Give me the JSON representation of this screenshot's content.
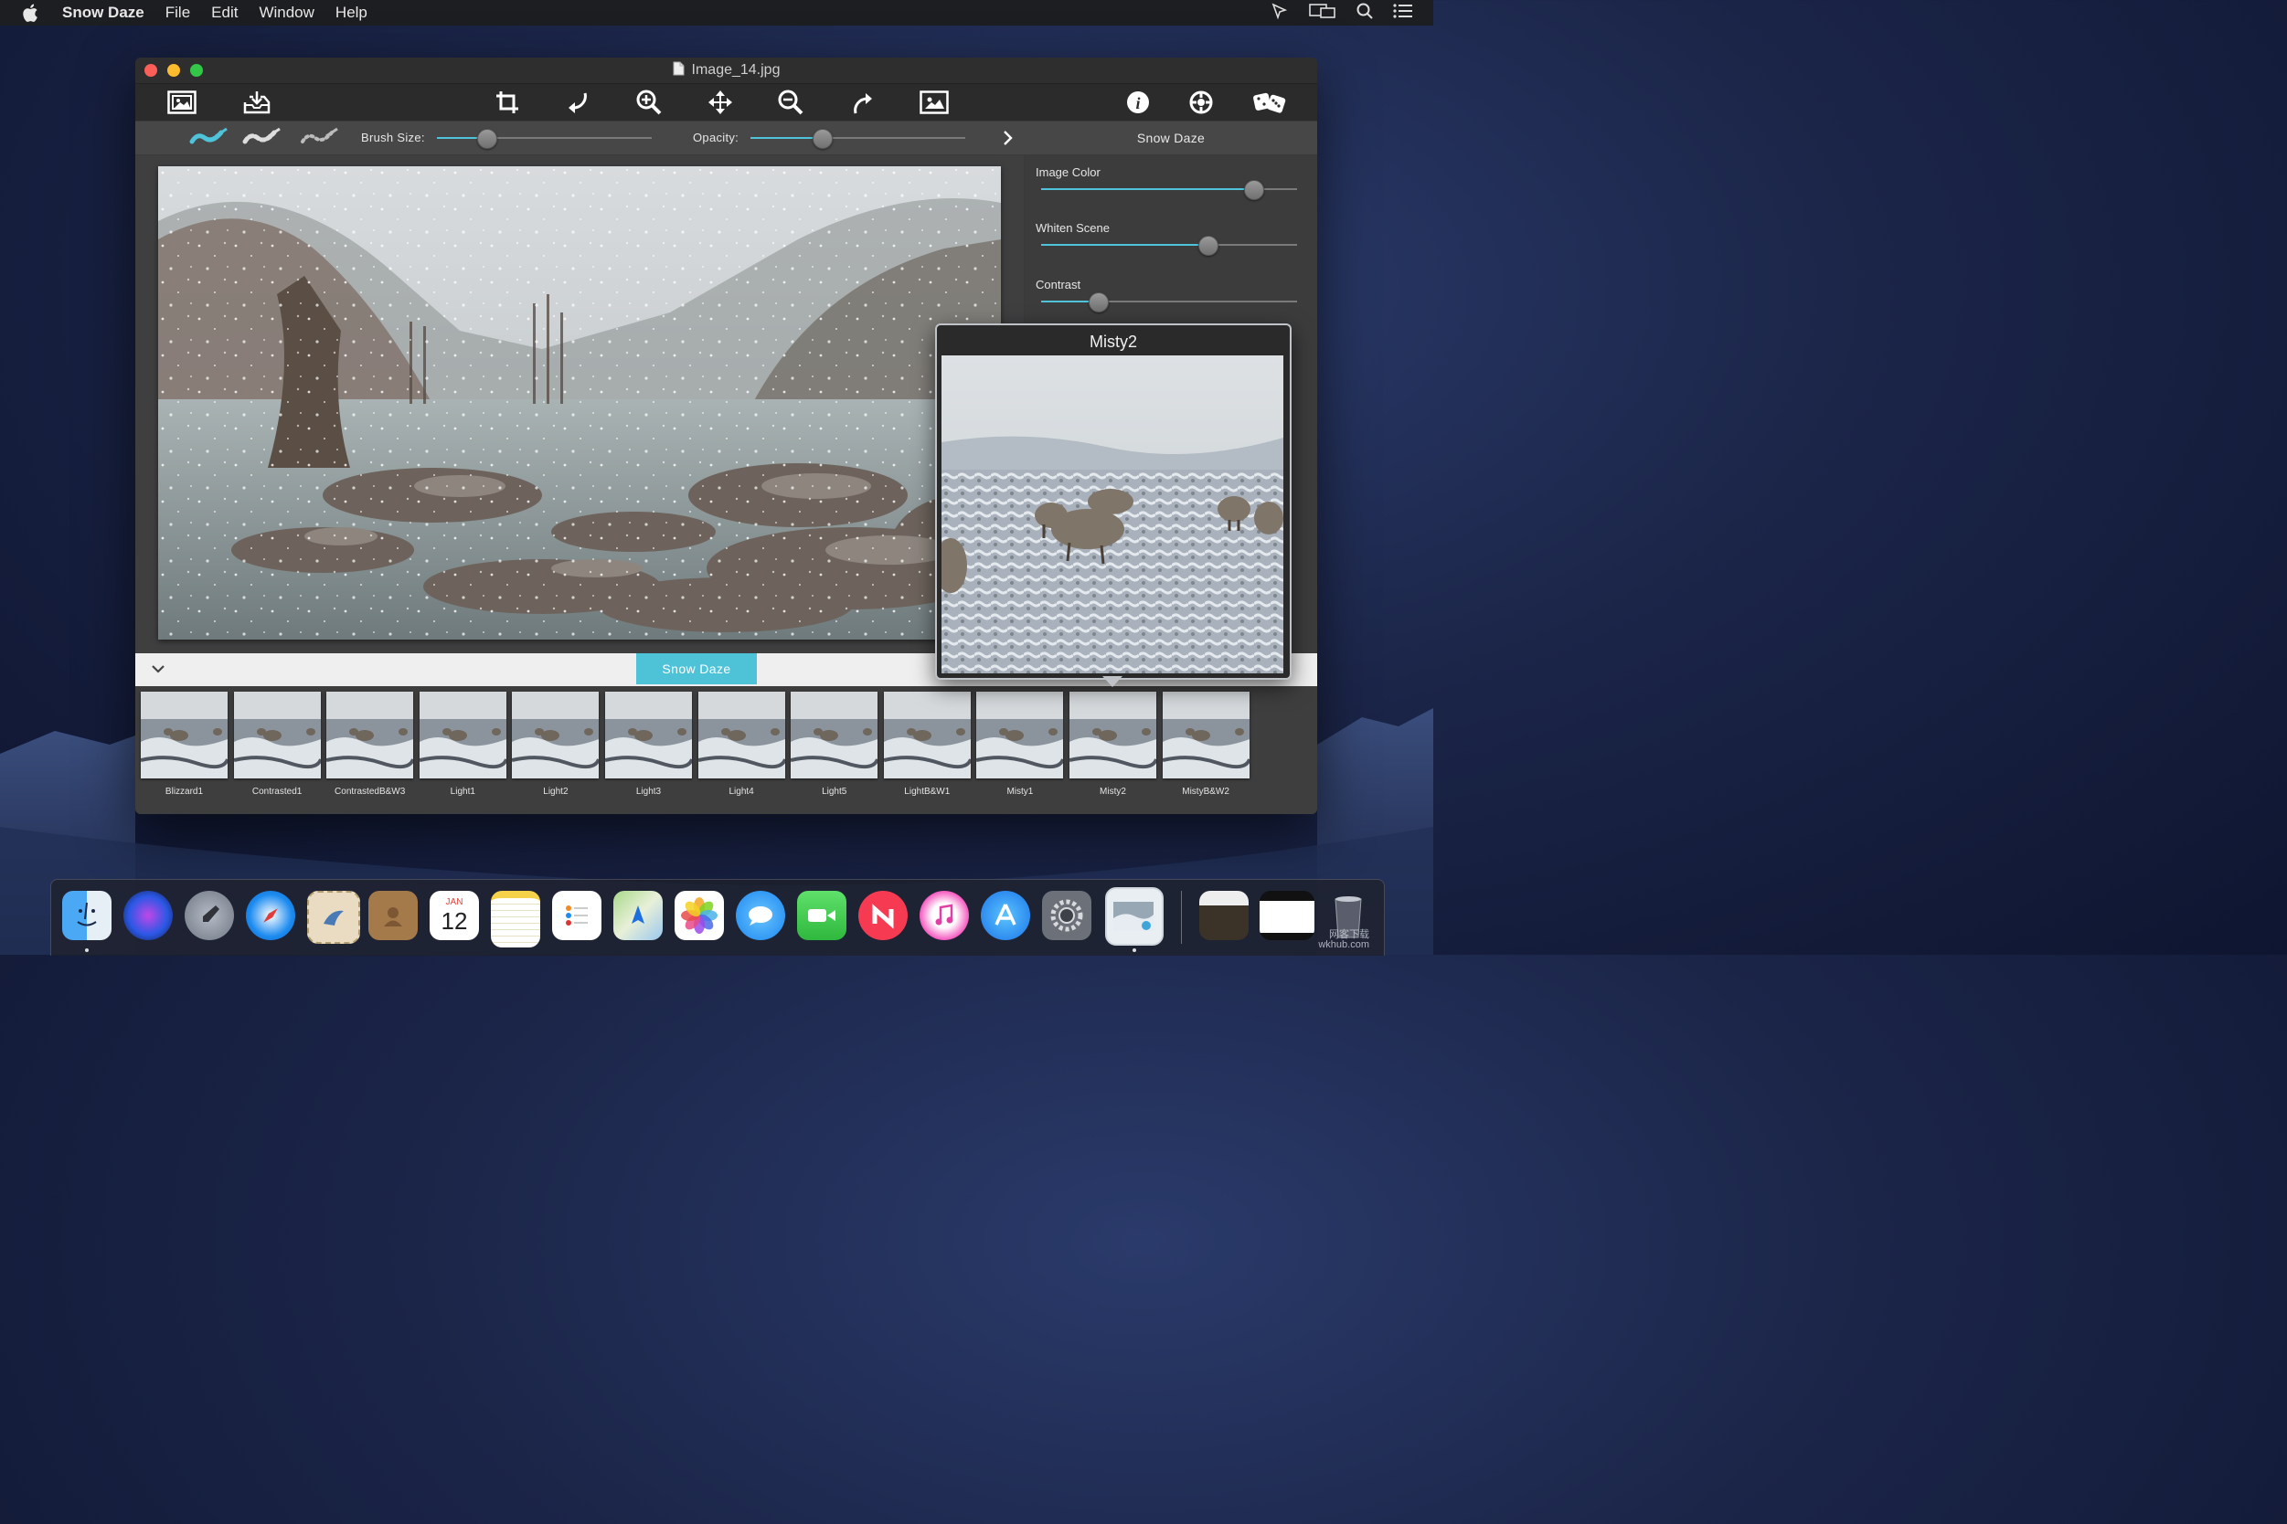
{
  "menubar": {
    "app_name": "Snow Daze",
    "items": [
      "File",
      "Edit",
      "Window",
      "Help"
    ]
  },
  "window": {
    "title": "Image_14.jpg"
  },
  "toolbar": {
    "icons": [
      "open-image-icon",
      "export-icon",
      "crop-icon",
      "rotate-left-icon",
      "zoom-in-icon",
      "move-icon",
      "zoom-out-icon",
      "rotate-right-icon",
      "fit-image-icon",
      "info-icon",
      "settings-icon",
      "random-dice-icon"
    ]
  },
  "brushbar": {
    "brush_size_label": "Brush Size:",
    "brush_size_value": 0.23,
    "opacity_label": "Opacity:",
    "opacity_value": 0.33
  },
  "sidepanel": {
    "title": "Snow Daze",
    "sliders": [
      {
        "label": "Image Color",
        "value": 0.83
      },
      {
        "label": "Whiten Scene",
        "value": 0.65
      },
      {
        "label": "Contrast",
        "value": 0.22
      }
    ]
  },
  "bottombar": {
    "active_tab": "Snow Daze"
  },
  "presets": {
    "items": [
      "Blizzard1",
      "Contrasted1",
      "ContrastedB&W3",
      "Light1",
      "Light2",
      "Light3",
      "Light4",
      "Light5",
      "LightB&W1",
      "Misty1",
      "Misty2",
      "MistyB&W2"
    ],
    "selected": "Misty2"
  },
  "popover": {
    "title": "Misty2"
  },
  "dock": {
    "apps": [
      "Finder",
      "Siri",
      "Launchpad",
      "Safari",
      "Mail",
      "Contacts",
      "Calendar",
      "Notes",
      "Reminders",
      "Maps",
      "Photos",
      "Messages",
      "FaceTime",
      "News",
      "iTunes",
      "App Store",
      "System Preferences",
      "Snow Daze",
      "Downloads",
      "Documents",
      "Trash"
    ],
    "calendar_month": "JAN",
    "calendar_day": "12"
  },
  "watermark": {
    "line1": "网客下载",
    "line2": "wkhub.com"
  }
}
